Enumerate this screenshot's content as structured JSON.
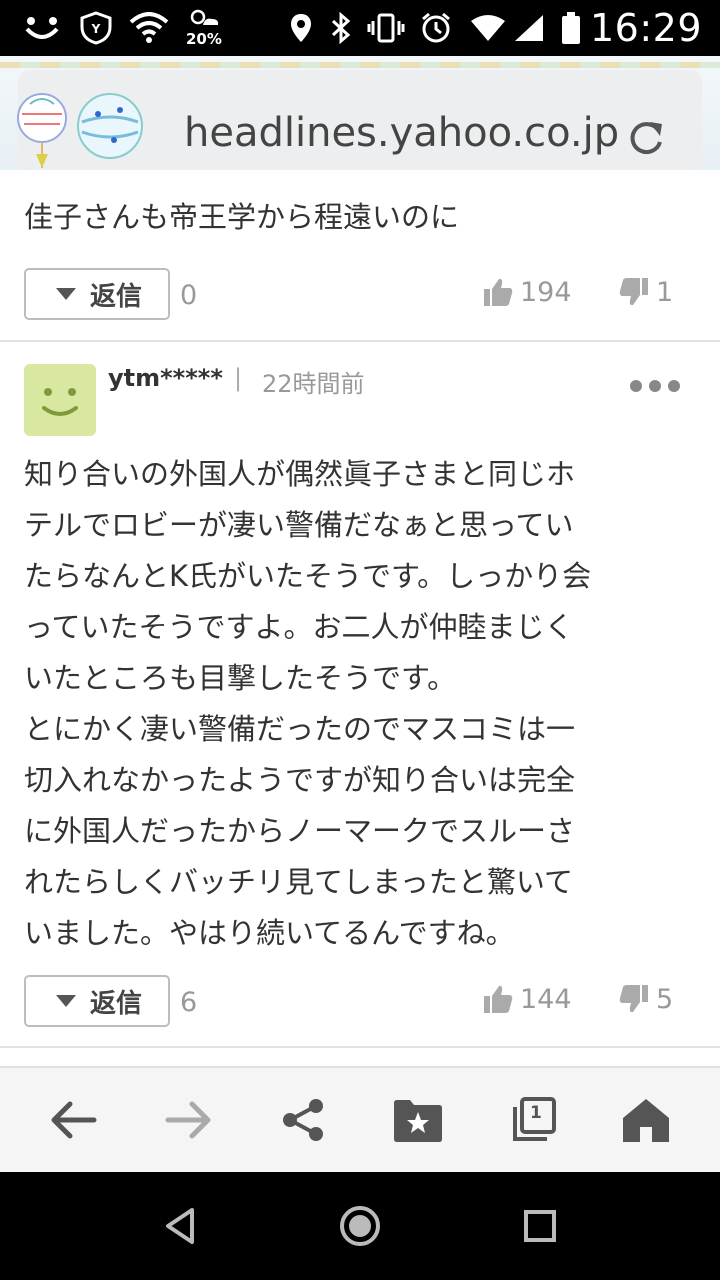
{
  "status_bar": {
    "battery_percent": "20%",
    "time": "16:29"
  },
  "browser": {
    "url": "headlines.yahoo.co.jp",
    "reload_icon": "reload-icon"
  },
  "comments": [
    {
      "text": "佳子さんも帝王学から程遠いのに",
      "reply_label": "返信",
      "reply_count": "0",
      "likes": "194",
      "dislikes": "1"
    },
    {
      "username": "ytm*****",
      "separator": "|",
      "timestamp": "22時間前",
      "text_lines": [
        "知り合いの外国人が偶然眞子さまと同じホ",
        "テルでロビーが凄い警備だなぁと思ってい",
        "たらなんとK氏がいたそうです。しっかり会",
        "っていたそうですよ。お二人が仲睦まじく",
        "いたところも目撃したそうです。",
        "とにかく凄い警備だったのでマスコミは一",
        "切入れなかったようですが知り合いは完全",
        "に外国人だったからノーマークでスルーさ",
        "れたらしくバッチリ見てしまったと驚いて",
        "いました。やはり続いてるんですね。"
      ],
      "reply_label": "返信",
      "reply_count": "6",
      "likes": "144",
      "dislikes": "5"
    }
  ],
  "toolbar": {
    "tab_count": "1"
  },
  "colors": {
    "avatar_bg": "#d9e8a0",
    "status_bar_bg": "#000000",
    "text": "#333333",
    "muted": "#999999"
  }
}
